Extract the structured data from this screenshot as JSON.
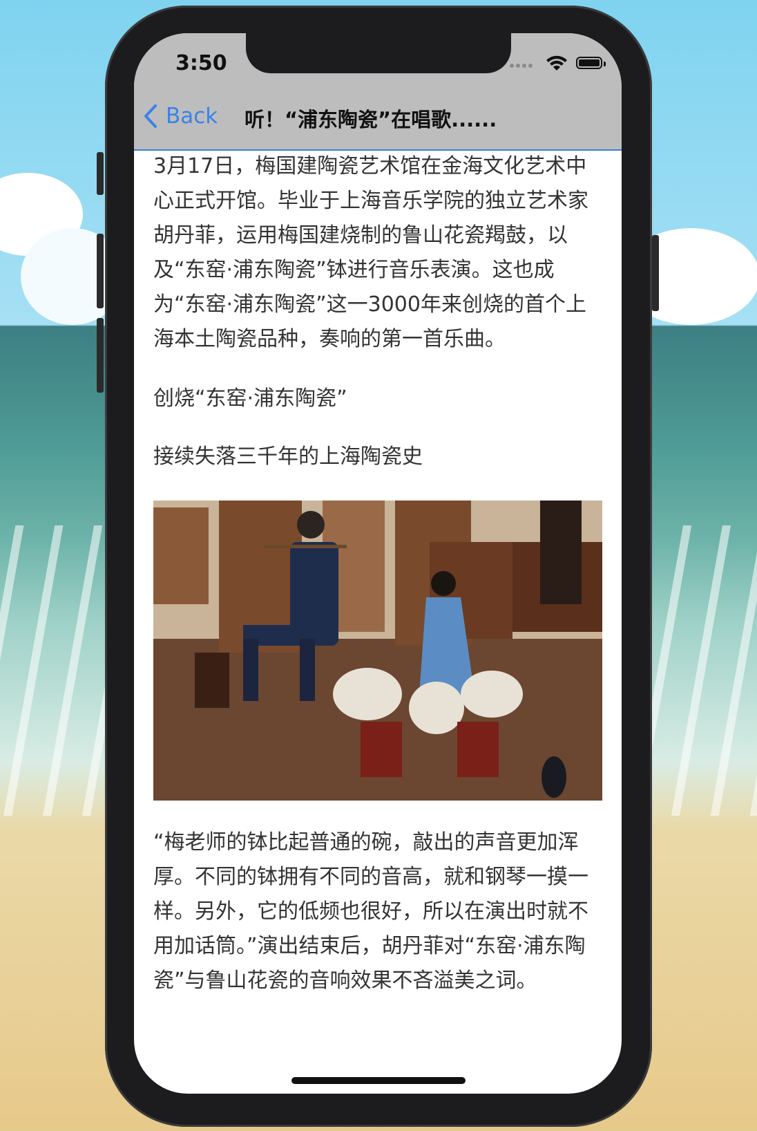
{
  "status_bar": {
    "time": "3:50"
  },
  "nav": {
    "back_label": "Back",
    "title": "听！“浦东陶瓷”在唱歌......"
  },
  "article": {
    "paragraph_1": "3月17日，梅国建陶瓷艺术馆在金海文化艺术中心正式开馆。毕业于上海音乐学院的独立艺术家胡丹菲，运用梅国建烧制的鲁山花瓷羯鼓，以及“东窑·浦东陶瓷”钵进行音乐表演。这也成为“东窑·浦东陶瓷”这一3000年来创烧的首个上海本土陶瓷品种，奏响的第一首乐曲。",
    "heading_1": "创烧“东窑·浦东陶瓷”",
    "heading_2": "接续失落三千年的上海陶瓷史",
    "paragraph_2": "“梅老师的钵比起普通的碗，敲出的声音更加浑厚。不同的钵拥有不同的音高，就和钢琴一摸一样。另外，它的低频也很好，所以在演出时就不用加话筒。”演出结束后，胡丹菲对“东窑·浦东陶瓷”与鲁山花瓷的音响效果不吝溢美之词。"
  },
  "colors": {
    "accent": "#3b82e8",
    "navbar_bg": "#bdbdbd",
    "text": "#333333"
  },
  "icons": {
    "back": "chevron-left-icon",
    "wifi": "wifi-icon",
    "battery": "battery-icon"
  }
}
